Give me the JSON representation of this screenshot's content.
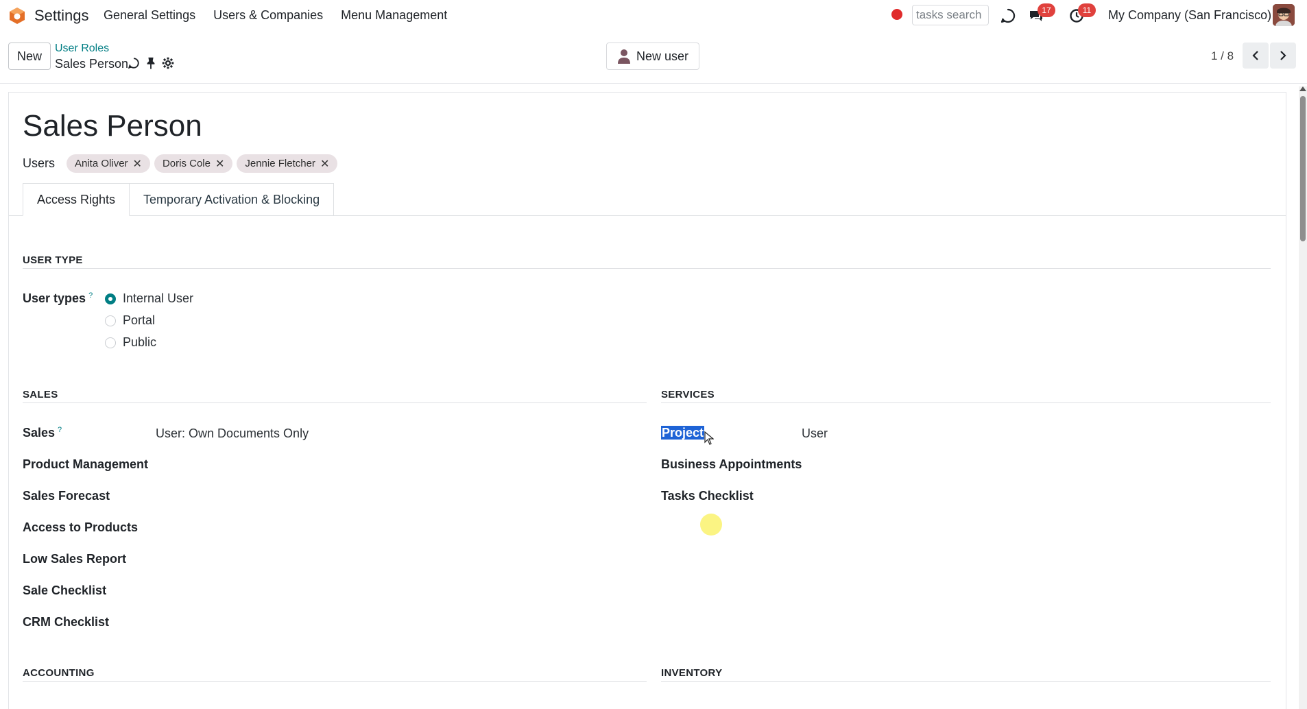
{
  "navbar": {
    "app_title": "Settings",
    "menu": [
      "General Settings",
      "Users & Companies",
      "Menu Management"
    ],
    "search_placeholder": "tasks search",
    "messages_count": "17",
    "activities_count": "11",
    "company": "My Company (San Francisco)"
  },
  "control_panel": {
    "new_label": "New",
    "breadcrumb_parent": "User Roles",
    "breadcrumb_current": "Sales Person",
    "new_user_label": "New user",
    "pager": "1 / 8"
  },
  "record": {
    "title": "Sales Person",
    "users_label": "Users",
    "users": [
      "Anita Oliver",
      "Doris Cole",
      "Jennie Fletcher"
    ],
    "tabs": [
      "Access Rights",
      "Temporary Activation & Blocking"
    ]
  },
  "user_type": {
    "heading": "USER TYPE",
    "label": "User types",
    "help": "?",
    "options": [
      "Internal User",
      "Portal",
      "Public"
    ],
    "selected": "Internal User"
  },
  "sales": {
    "heading": "SALES",
    "sales_label": "Sales",
    "sales_help": "?",
    "sales_value": "User: Own Documents Only",
    "fields": [
      "Product Management",
      "Sales Forecast",
      "Access to Products",
      "Low Sales Report",
      "Sale Checklist",
      "CRM Checklist"
    ]
  },
  "services": {
    "heading": "SERVICES",
    "project_label": "Project",
    "project_value": "User",
    "fields": [
      "Business Appointments",
      "Tasks Checklist"
    ]
  },
  "bottom_sections": {
    "accounting": "ACCOUNTING",
    "inventory": "INVENTORY"
  },
  "colors": {
    "accent": "#017e84",
    "badge": "#e0413d",
    "selection": "#1e63d6"
  }
}
